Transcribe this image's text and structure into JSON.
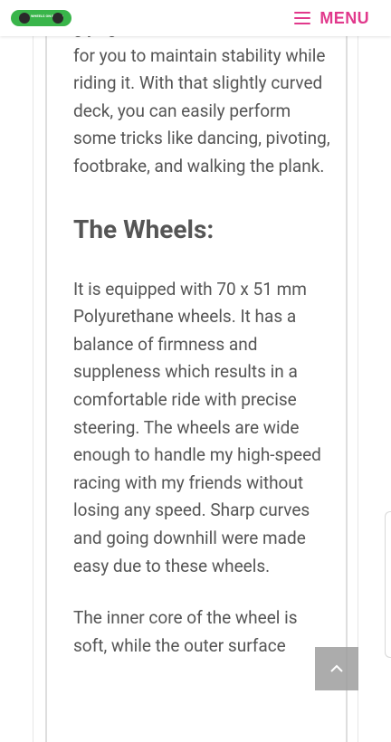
{
  "header": {
    "logo_text": "WHEELS ON BOARD",
    "menu_label": "MENU"
  },
  "article": {
    "para_top_partial": "g          y    ,               g",
    "para_top": "for you to maintain stability while riding it. With that slightly curved deck, you can easily perform some tricks like dancing, pivoting, footbrake, and walking the plank.",
    "heading_wheels": "The Wheels:",
    "para_wheels": "It is equipped with 70 x 51 mm Polyurethane wheels. It has a balance of firmness and suppleness which results in a comfortable ride with precise steering. The wheels are wide enough to handle my high-speed racing with my friends without losing any speed. Sharp curves and going downhill were made easy due to these wheels.",
    "para_core": "The inner core of the wheel is soft, while the outer surface"
  },
  "colors": {
    "accent": "#e1398c",
    "logo_green": "#39b54a",
    "text": "#555555",
    "scroll_button": "#9e9e9e"
  },
  "icons": {
    "menu": "hamburger-icon",
    "scroll_top": "chevron-up-icon"
  }
}
